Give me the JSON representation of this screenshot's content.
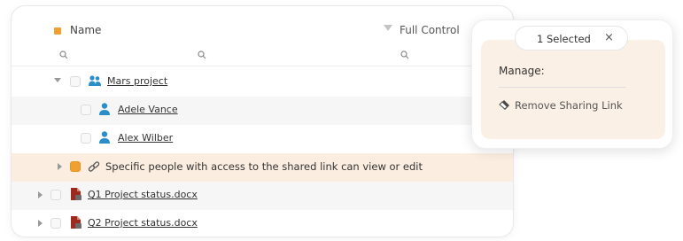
{
  "header": {
    "name_label": "Name",
    "full_control_label": "Full Control"
  },
  "search": {
    "icons": [
      "search-icon",
      "search-icon",
      "search-icon"
    ]
  },
  "rows": [
    {
      "label": "Mars project",
      "icon": "group-icon",
      "expanded": true
    },
    {
      "label": "Adele Vance",
      "icon": "user-icon"
    },
    {
      "label": "Alex Wilber",
      "icon": "user-icon"
    },
    {
      "label": "Specific people with access to the shared link can view or edit",
      "icon": "link-icon",
      "checked": true
    },
    {
      "label": "Q1 Project status.docx",
      "icon": "document-icon"
    },
    {
      "label": "Q2 Project status.docx",
      "icon": "document-icon"
    }
  ],
  "selection_popup": {
    "selected_label": "1 Selected",
    "close_glyph": "×",
    "manage_label": "Manage:",
    "remove_link_label": "Remove Sharing Link"
  },
  "colors": {
    "accent": "#f0a030",
    "selected_row": "#fbeee0",
    "user_icon": "#2a8fc7",
    "document_icon": "#9c2a1e"
  }
}
